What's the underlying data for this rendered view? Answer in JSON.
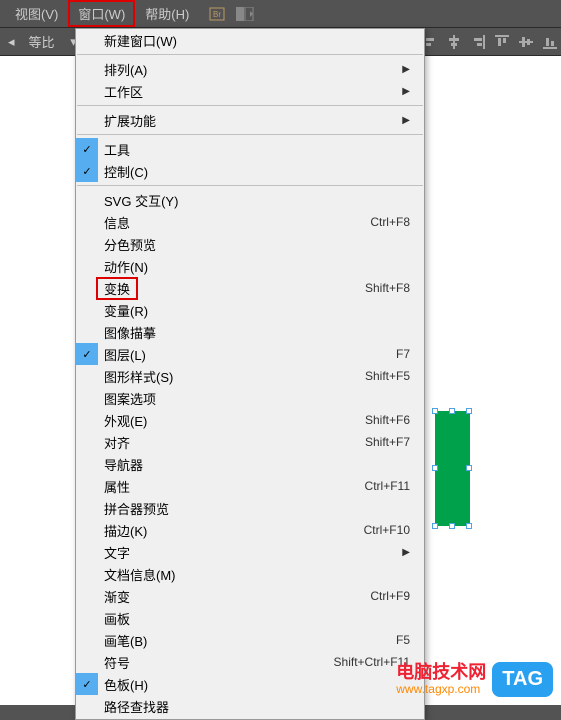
{
  "menubar": {
    "view": "视图(V)",
    "window": "窗口(W)",
    "help": "帮助(H)"
  },
  "toolbar": {
    "label1": "等比"
  },
  "menu": {
    "new_window": "新建窗口(W)",
    "arrange": "排列(A)",
    "workspace": "工作区",
    "extensions": "扩展功能",
    "tools": "工具",
    "control": "控制(C)",
    "svg_interact": "SVG 交互(Y)",
    "info": "信息",
    "info_sc": "Ctrl+F8",
    "sep_preview": "分色预览",
    "actions": "动作(N)",
    "transform": "变换",
    "transform_sc": "Shift+F8",
    "variables": "变量(R)",
    "image_trace": "图像描摹",
    "layers": "图层(L)",
    "layers_sc": "F7",
    "graphic_styles": "图形样式(S)",
    "graphic_styles_sc": "Shift+F5",
    "pattern_options": "图案选项",
    "appearance": "外观(E)",
    "appearance_sc": "Shift+F6",
    "align": "对齐",
    "align_sc": "Shift+F7",
    "navigator": "导航器",
    "attributes": "属性",
    "attributes_sc": "Ctrl+F11",
    "flattener": "拼合器预览",
    "stroke": "描边(K)",
    "stroke_sc": "Ctrl+F10",
    "text": "文字",
    "doc_info": "文档信息(M)",
    "gradient": "渐变",
    "gradient_sc": "Ctrl+F9",
    "artboards": "画板",
    "brushes": "画笔(B)",
    "brushes_sc": "F5",
    "symbols": "符号",
    "symbols_sc": "Shift+Ctrl+F11",
    "swatches": "色板(H)",
    "truncated": "路径查找器"
  },
  "watermark": {
    "text": "电脑技术网",
    "url": "www.tagxp.com",
    "tag": "TAG"
  }
}
